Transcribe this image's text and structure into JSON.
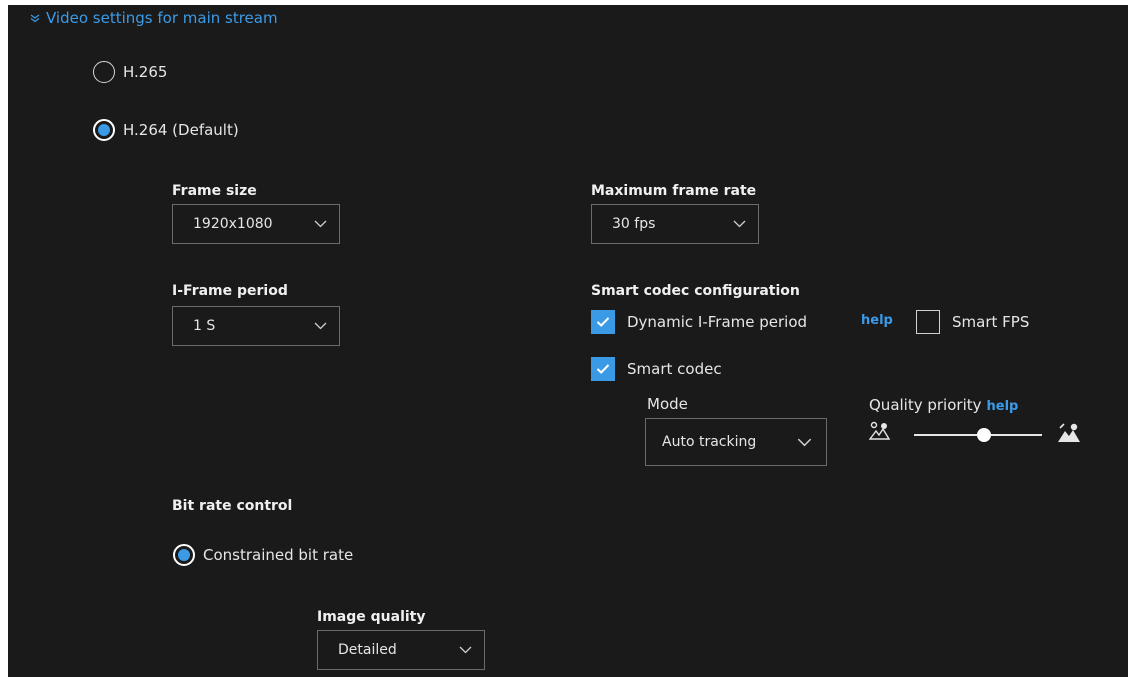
{
  "section": {
    "title": "Video settings for main stream"
  },
  "codec": {
    "options": [
      {
        "label": "H.265",
        "selected": false
      },
      {
        "label": "H.264 (Default)",
        "selected": true
      }
    ]
  },
  "frame_size": {
    "label": "Frame size",
    "value": "1920x1080"
  },
  "max_frame_rate": {
    "label": "Maximum frame rate",
    "value": "30 fps"
  },
  "iframe_period": {
    "label": "I-Frame period",
    "value": "1 S"
  },
  "smart_codec_config": {
    "label": "Smart codec configuration",
    "dynamic_iframe": {
      "label": "Dynamic I-Frame period",
      "checked": true
    },
    "help_link": "help",
    "smart_fps": {
      "label": "Smart FPS",
      "checked": false
    },
    "smart_codec": {
      "label": "Smart codec",
      "checked": true
    },
    "mode": {
      "label": "Mode",
      "value": "Auto tracking"
    },
    "quality_priority": {
      "label": "Quality priority",
      "help": "help",
      "level": 0.55
    }
  },
  "bit_rate": {
    "label": "Bit rate control",
    "option": {
      "label": "Constrained bit rate",
      "selected": true
    }
  },
  "image_quality": {
    "label": "Image quality",
    "value": "Detailed"
  },
  "colors": {
    "accent": "#3a9ae6",
    "background": "#1a1a1a",
    "link": "#3b9be8"
  }
}
